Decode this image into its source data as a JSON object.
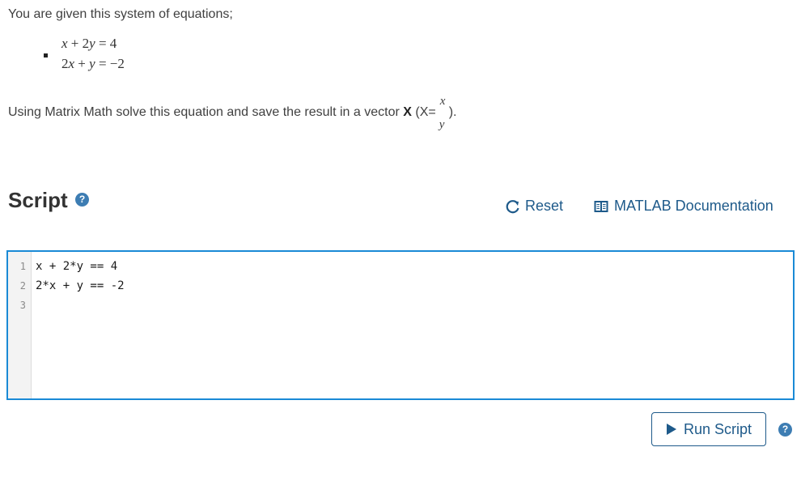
{
  "problem": {
    "intro": "You are given this system of equations;",
    "equations": [
      {
        "parts": [
          [
            "v",
            "x"
          ],
          [
            "t",
            " + 2"
          ],
          [
            "v",
            "y"
          ],
          [
            "t",
            " = 4"
          ]
        ]
      },
      {
        "parts": [
          [
            "t",
            "2"
          ],
          [
            "v",
            "x"
          ],
          [
            "t",
            " + "
          ],
          [
            "v",
            "y"
          ],
          [
            "t",
            " = −2"
          ]
        ]
      }
    ],
    "task_prefix": "Using Matrix Math solve this equation and save the result in a vector ",
    "task_bold": "X",
    "task_paren_open": " (X=",
    "vector_top": "x",
    "vector_bottom": "y",
    "task_suffix": ")."
  },
  "script": {
    "title": "Script",
    "help_glyph": "?",
    "reset_label": "Reset",
    "doc_label": "MATLAB Documentation"
  },
  "editor": {
    "lines": [
      "x + 2*y == 4",
      "2*x + y == -2",
      ""
    ],
    "line_numbers": [
      "1",
      "2",
      "3"
    ]
  },
  "actions": {
    "run_label": "Run Script",
    "help_glyph": "?"
  },
  "colors": {
    "accent": "#1e5a8a",
    "editor_border": "#1a8ad6",
    "help_icon": "#3d7db3"
  }
}
